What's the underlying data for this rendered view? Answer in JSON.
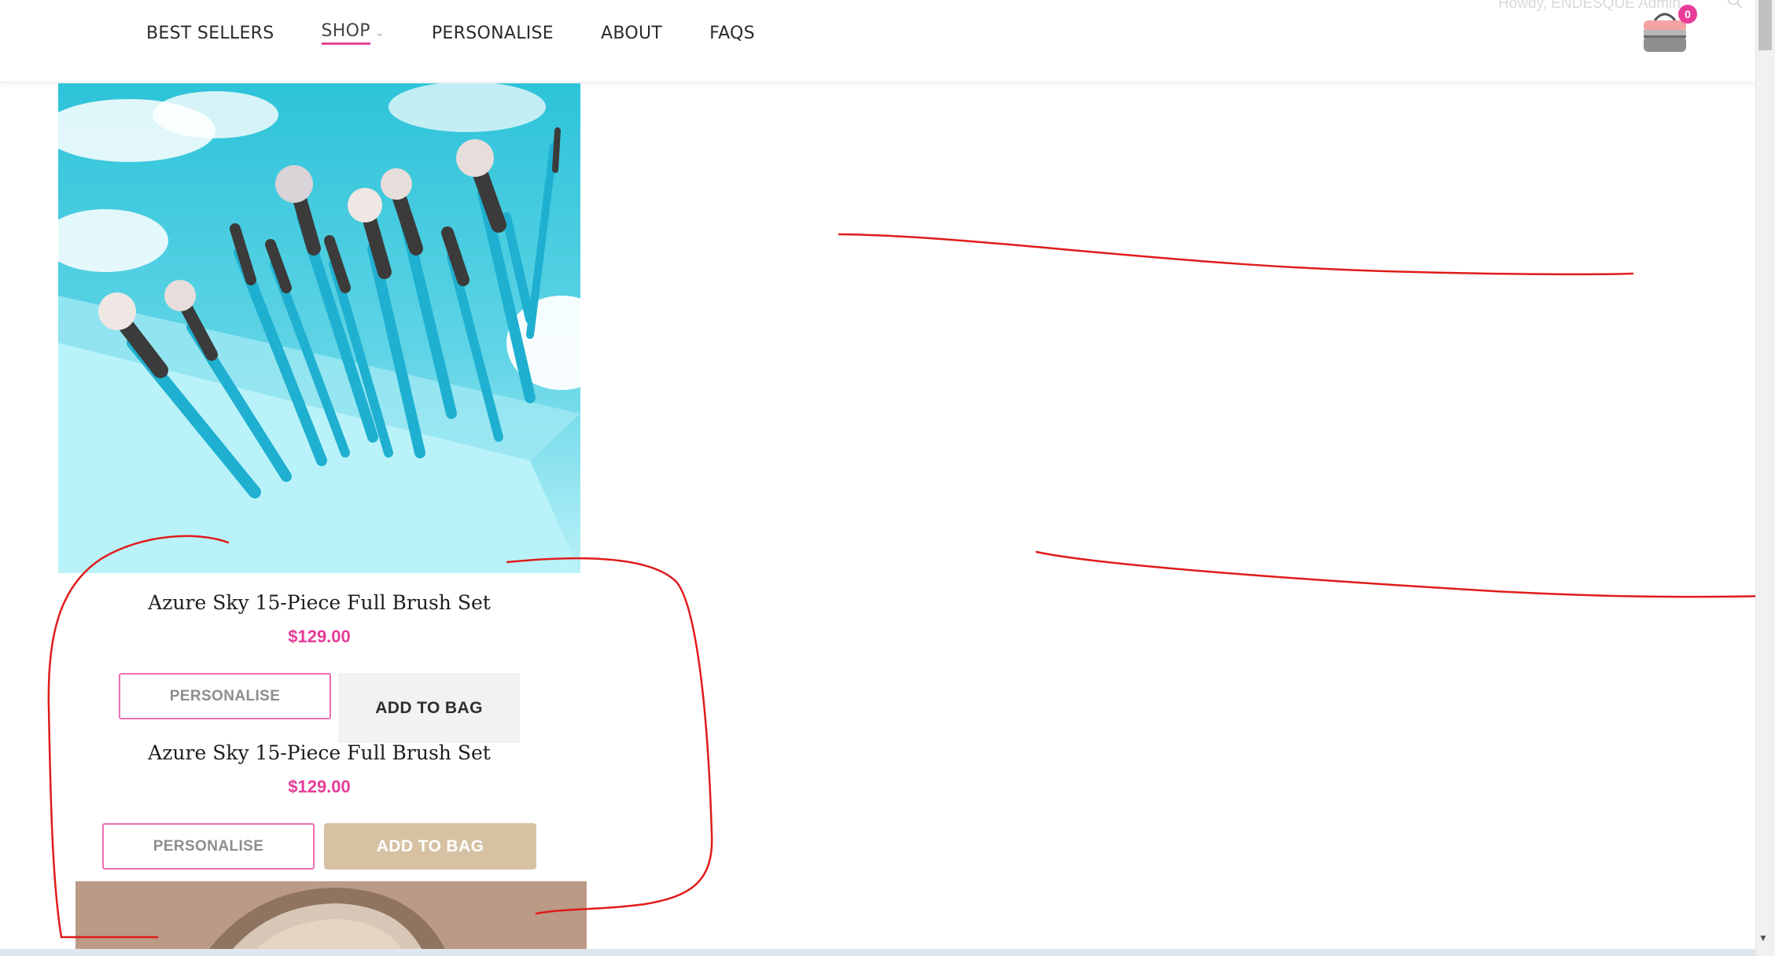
{
  "header": {
    "nav": [
      {
        "label": "BEST SELLERS"
      },
      {
        "label": "SHOP",
        "has_dropdown": true,
        "active": true
      },
      {
        "label": "PERSONALISE"
      },
      {
        "label": "ABOUT"
      },
      {
        "label": "FAQS"
      }
    ],
    "howdy_text": "Howdy, ENDESQUE Admin",
    "bag_count": "0",
    "accent_color": "#e53c98"
  },
  "products": [
    {
      "title": "Azure Sky 15-Piece Full Brush Set",
      "price": "$129.00",
      "personalise_label": "PERSONALISE",
      "add_label": "ADD TO BAG"
    },
    {
      "title": "Azure Sky 15-Piece Full Brush Set",
      "price": "$129.00",
      "personalise_label": "PERSONALISE",
      "add_label": "ADD TO BAG"
    }
  ],
  "icons": {
    "bag": "cosmetic-bag-icon",
    "search": "search-icon",
    "chevron": "chevron-down-icon"
  }
}
